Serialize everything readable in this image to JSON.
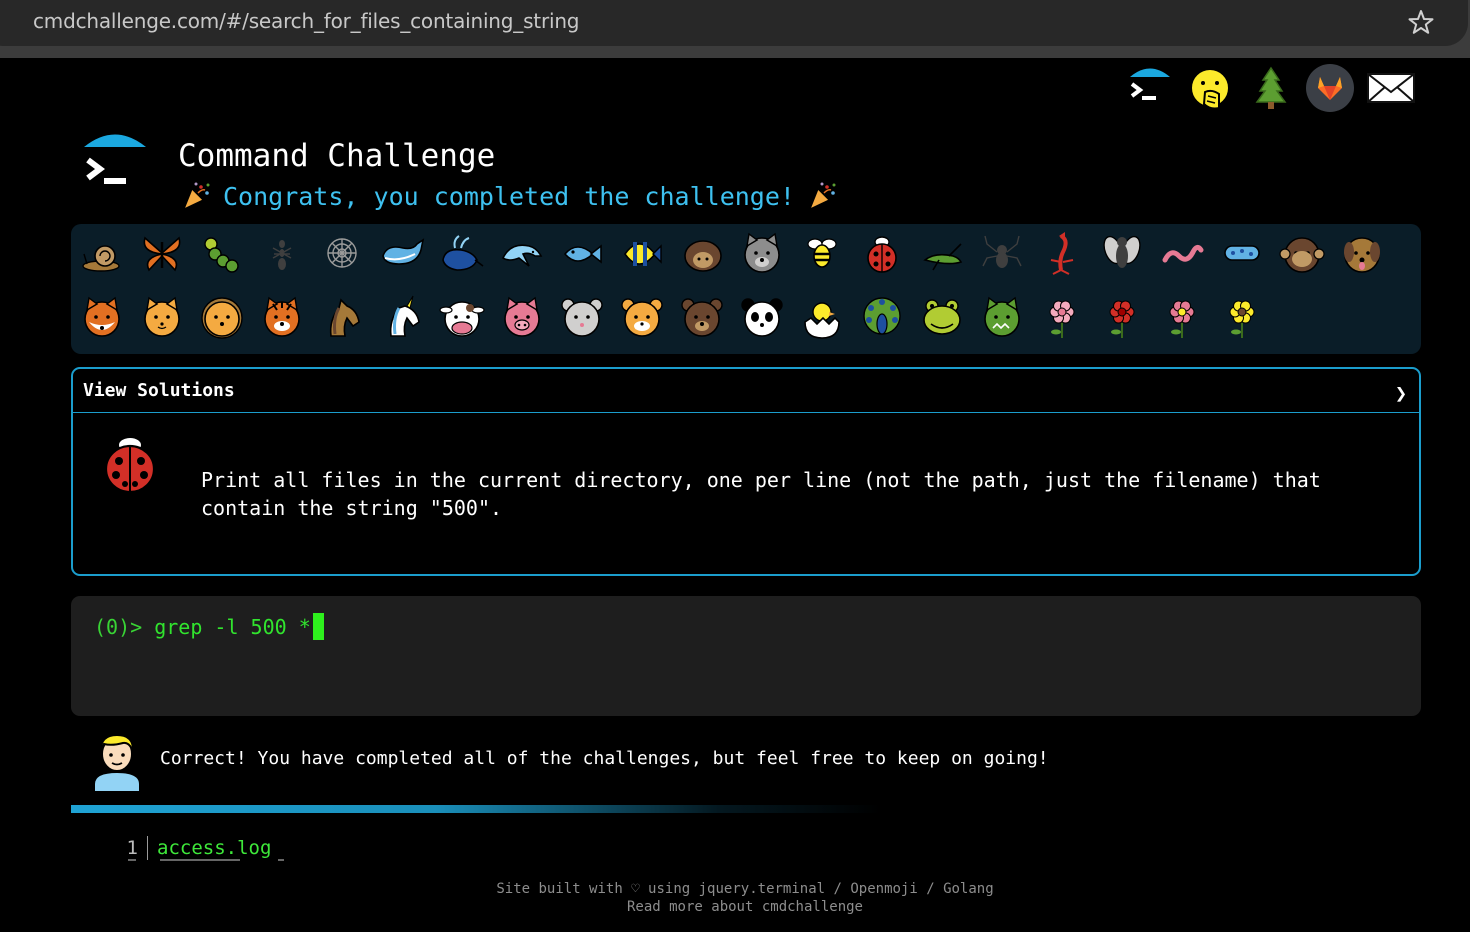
{
  "browser": {
    "url": "cmdchallenge.com/#/search_for_files_containing_string",
    "icons": [
      "tune-icon",
      "star-icon"
    ]
  },
  "top_icons": [
    "cmdchallenge-logo-icon",
    "face-with-hand-over-mouth-icon",
    "evergreen-tree-icon",
    "gitlab-icon",
    "envelope-icon"
  ],
  "header": {
    "title": "Command Challenge",
    "congrats": "Congrats, you completed the challenge!"
  },
  "badges": {
    "row1": [
      "snail-icon",
      "butterfly-icon",
      "caterpillar-icon",
      "ant-icon",
      "spider-web-icon",
      "whale-icon",
      "spouting-whale-icon",
      "dolphin-icon",
      "fish-icon",
      "tropical-fish-icon",
      "hedgehog-icon",
      "wolf-icon",
      "bee-icon",
      "ladybug-icon",
      "cricket-icon",
      "spider-icon",
      "scorpion-icon",
      "fly-icon",
      "worm-icon",
      "microbe-icon",
      "monkey-face-icon",
      "dog-face-icon"
    ],
    "row2": [
      "fox-icon",
      "cat-face-icon",
      "lion-icon",
      "tiger-face-icon",
      "horse-icon",
      "unicorn-icon",
      "cow-face-icon",
      "pig-face-icon",
      "mouse-face-icon",
      "hamster-icon",
      "bear-icon",
      "panda-icon",
      "hatching-chick-icon",
      "peacock-icon",
      "frog-icon",
      "dragon-face-icon",
      "cherry-blossom-icon",
      "rose-icon",
      "hibiscus-icon",
      "sunflower-icon"
    ]
  },
  "solutions": {
    "header": "View Solutions",
    "chevron": "❯",
    "task": "Print all files in the current directory, one per line (not the path, just the filename) that contain the string \"500\"."
  },
  "terminal": {
    "prompt": "(0)> ",
    "command": "grep -l 500 *"
  },
  "result": {
    "message": "Correct! You have completed all of the challenges, but feel free to keep on going!",
    "progress": 1.0
  },
  "output": [
    {
      "line": "1",
      "text": "access.log"
    }
  ],
  "footer": {
    "line1": "Site built with ♡ using jquery.terminal / Openmoji / Golang",
    "line2": "Read more about cmdchallenge"
  },
  "colors": {
    "accent": "#1b9dcc",
    "congrats": "#3ec1f0",
    "terminal_green": "#31e42e",
    "panel_bg": "#0a1d28"
  }
}
